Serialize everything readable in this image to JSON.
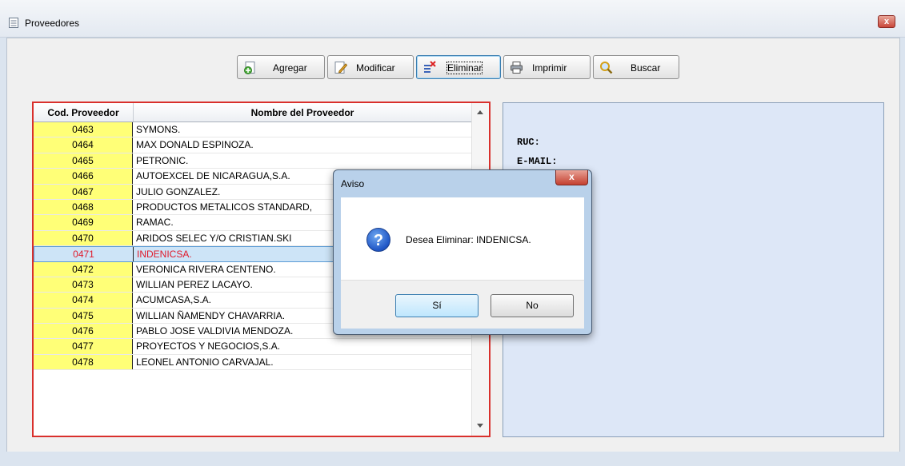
{
  "window": {
    "title": "Proveedores",
    "close_glyph": "x"
  },
  "toolbar": [
    {
      "id": "agregar",
      "label": "Agregar",
      "icon": "add-document-icon"
    },
    {
      "id": "modificar",
      "label": "Modificar",
      "icon": "edit-document-icon"
    },
    {
      "id": "eliminar",
      "label": "Eliminar",
      "icon": "delete-icon"
    },
    {
      "id": "imprimir",
      "label": "Imprimir",
      "icon": "printer-icon"
    },
    {
      "id": "buscar",
      "label": "Buscar",
      "icon": "magnifier-icon"
    }
  ],
  "grid": {
    "columns": [
      "Cod. Proveedor",
      "Nombre del Proveedor"
    ],
    "selected_code": "0471",
    "rows": [
      {
        "code": "0463",
        "name": "SYMONS."
      },
      {
        "code": "0464",
        "name": "MAX DONALD ESPINOZA."
      },
      {
        "code": "0465",
        "name": "PETRONIC."
      },
      {
        "code": "0466",
        "name": "AUTOEXCEL DE NICARAGUA,S.A."
      },
      {
        "code": "0467",
        "name": "JULIO GONZALEZ."
      },
      {
        "code": "0468",
        "name": "PRODUCTOS METALICOS STANDARD,"
      },
      {
        "code": "0469",
        "name": "RAMAC."
      },
      {
        "code": "0470",
        "name": "ARIDOS SELEC Y/O CRISTIAN.SKI"
      },
      {
        "code": "0471",
        "name": "INDENICSA."
      },
      {
        "code": "0472",
        "name": "VERONICA RIVERA CENTENO."
      },
      {
        "code": "0473",
        "name": "WILLIAN PEREZ LACAYO."
      },
      {
        "code": "0474",
        "name": "ACUMCASA,S.A."
      },
      {
        "code": "0475",
        "name": "WILLIAN ÑAMENDY CHAVARRIA."
      },
      {
        "code": "0476",
        "name": "PABLO JOSE VALDIVIA MENDOZA."
      },
      {
        "code": "0477",
        "name": "PROYECTOS Y NEGOCIOS,S.A."
      },
      {
        "code": "0478",
        "name": "LEONEL ANTONIO CARVAJAL."
      }
    ]
  },
  "detail": {
    "ruc_label": "RUC:",
    "email_label": "E-MAIL:"
  },
  "dialog": {
    "title": "Aviso",
    "close_glyph": "x",
    "message": "Desea Eliminar: INDENICSA.",
    "icon": "question-icon",
    "yes_label": "Sí",
    "no_label": "No"
  },
  "colors": {
    "code_column": "#ffff77",
    "selection_text": "#e0192a",
    "grid_border": "#d9302c",
    "detail_bg": "#dde7f7"
  }
}
